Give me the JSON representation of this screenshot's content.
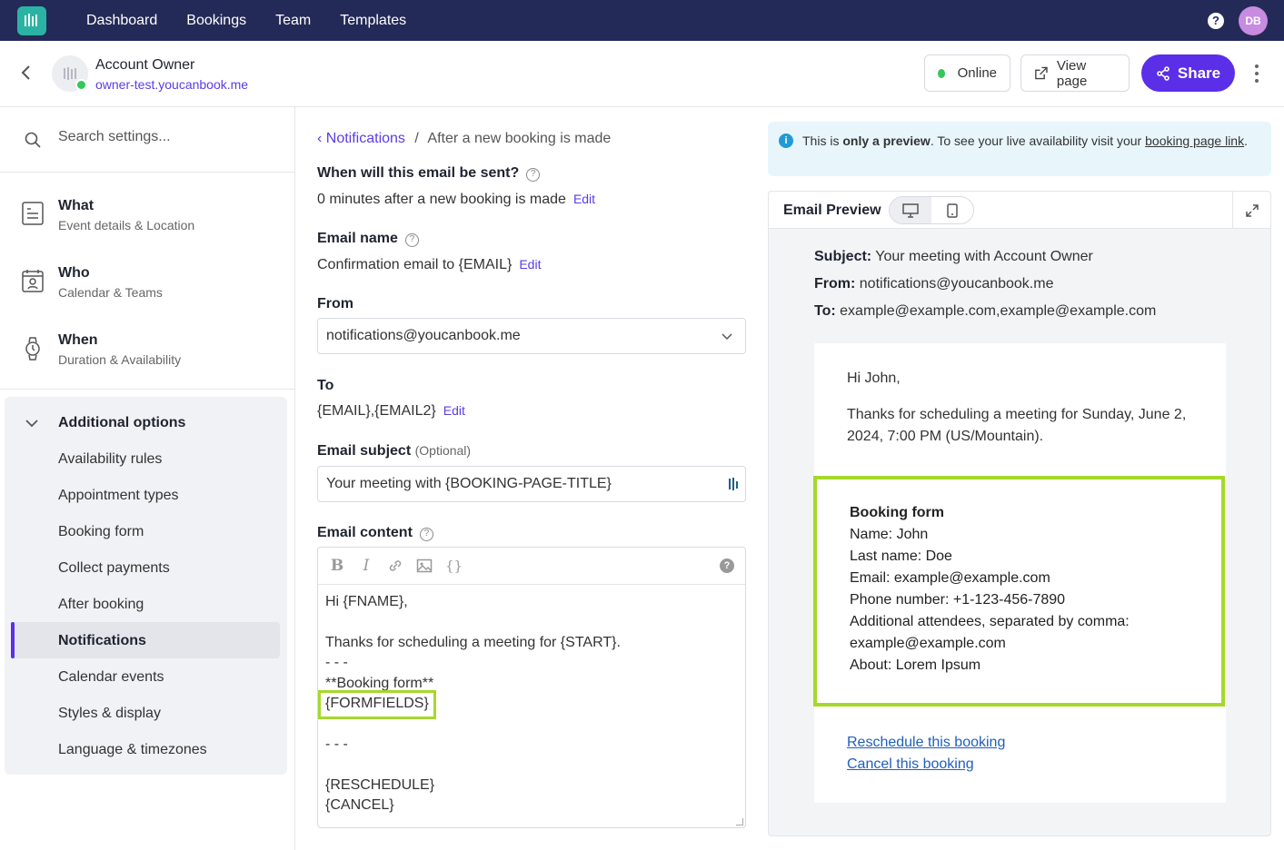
{
  "nav": {
    "links": [
      "Dashboard",
      "Bookings",
      "Team",
      "Templates"
    ],
    "help_label": "?",
    "avatar_initials": "DB"
  },
  "header": {
    "account_name": "Account Owner",
    "account_url": "owner-test.youcanbook.me",
    "status_label": "Online",
    "view_page_label": "View page",
    "share_label": "Share"
  },
  "sidebar": {
    "search_placeholder": "Search settings...",
    "groups": [
      {
        "title": "What",
        "subtitle": "Event details & Location"
      },
      {
        "title": "Who",
        "subtitle": "Calendar & Teams"
      },
      {
        "title": "When",
        "subtitle": "Duration & Availability"
      }
    ],
    "additional_title": "Additional options",
    "additional_items": [
      "Availability rules",
      "Appointment types",
      "Booking form",
      "Collect payments",
      "After booking",
      "Notifications",
      "Calendar events",
      "Styles & display",
      "Language & timezones"
    ],
    "active_item": "Notifications"
  },
  "form": {
    "breadcrumb_parent": "Notifications",
    "breadcrumb_sep": "/",
    "breadcrumb_current": "After a new booking is made",
    "when_label": "When will this email be sent?",
    "when_value": "0 minutes after a new booking is made",
    "edit_label": "Edit",
    "name_label": "Email name",
    "name_value": "Confirmation email to {EMAIL}",
    "from_label": "From",
    "from_value": "notifications@youcanbook.me",
    "to_label": "To",
    "to_value": "{EMAIL},{EMAIL2}",
    "subject_label": "Email subject",
    "subject_optional": "(Optional)",
    "subject_value": "Your meeting with {BOOKING-PAGE-TITLE}",
    "content_label": "Email content",
    "content_lines": [
      "Hi {FNAME},",
      "Thanks for scheduling a meeting for {START}.",
      "- - -",
      "**Booking form**",
      "{FORMFIELDS}",
      "- - -",
      "{RESCHEDULE}",
      "{CANCEL}"
    ],
    "toolbar": {
      "bold": "B",
      "italic": "I",
      "braces": "{}"
    }
  },
  "preview": {
    "notice_pre": "This is ",
    "notice_bold": "only a preview",
    "notice_mid": ". To see your live availability visit your ",
    "notice_link": "booking page link",
    "notice_end": ".",
    "title": "Email Preview",
    "subject_label": "Subject:",
    "subject_value": "Your meeting with Account Owner",
    "from_label": "From:",
    "from_value": "notifications@youcanbook.me",
    "to_label": "To:",
    "to_value": "example@example.com,example@example.com",
    "greeting": "Hi John,",
    "body_line1": "Thanks for scheduling a meeting for Sunday, June 2,",
    "body_line2": "2024, 7:00 PM (US/Mountain).",
    "booking_form_title": "Booking form",
    "booking_lines": [
      "Name: John",
      "Last name: Doe",
      "Email: example@example.com",
      "Phone number: +1-123-456-7890",
      "Additional attendees, separated by comma:",
      "example@example.com",
      "About: Lorem Ipsum"
    ],
    "reschedule_link": "Reschedule this booking",
    "cancel_link": "Cancel this booking"
  },
  "colors": {
    "accent": "#5b2ee8",
    "nav_bg": "#242a57",
    "highlight": "#a6d82a",
    "online": "#34c759"
  }
}
